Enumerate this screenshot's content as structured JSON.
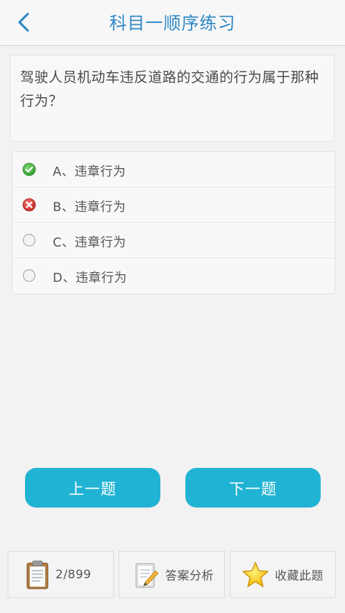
{
  "header": {
    "title": "科目一顺序练习"
  },
  "question": {
    "text": "驾驶人员机动车违反道路的交通的行为属于那种行为？"
  },
  "options": [
    {
      "label": "A、违章行为",
      "state": "correct"
    },
    {
      "label": "B、违章行为",
      "state": "wrong"
    },
    {
      "label": "C、违章行为",
      "state": "unselected"
    },
    {
      "label": "D、违章行为",
      "state": "unselected"
    }
  ],
  "nav": {
    "prev_label": "上一题",
    "next_label": "下一题"
  },
  "toolbar": {
    "progress": "2/899",
    "analysis_label": "答案分析",
    "favorite_label": "收藏此题",
    "icons": [
      "clipboard-icon",
      "notepad-pencil-icon",
      "star-icon"
    ]
  },
  "colors": {
    "accent": "#21b3d4",
    "title": "#2f88c6",
    "correct": "#3aa63a",
    "wrong": "#d8322e"
  }
}
